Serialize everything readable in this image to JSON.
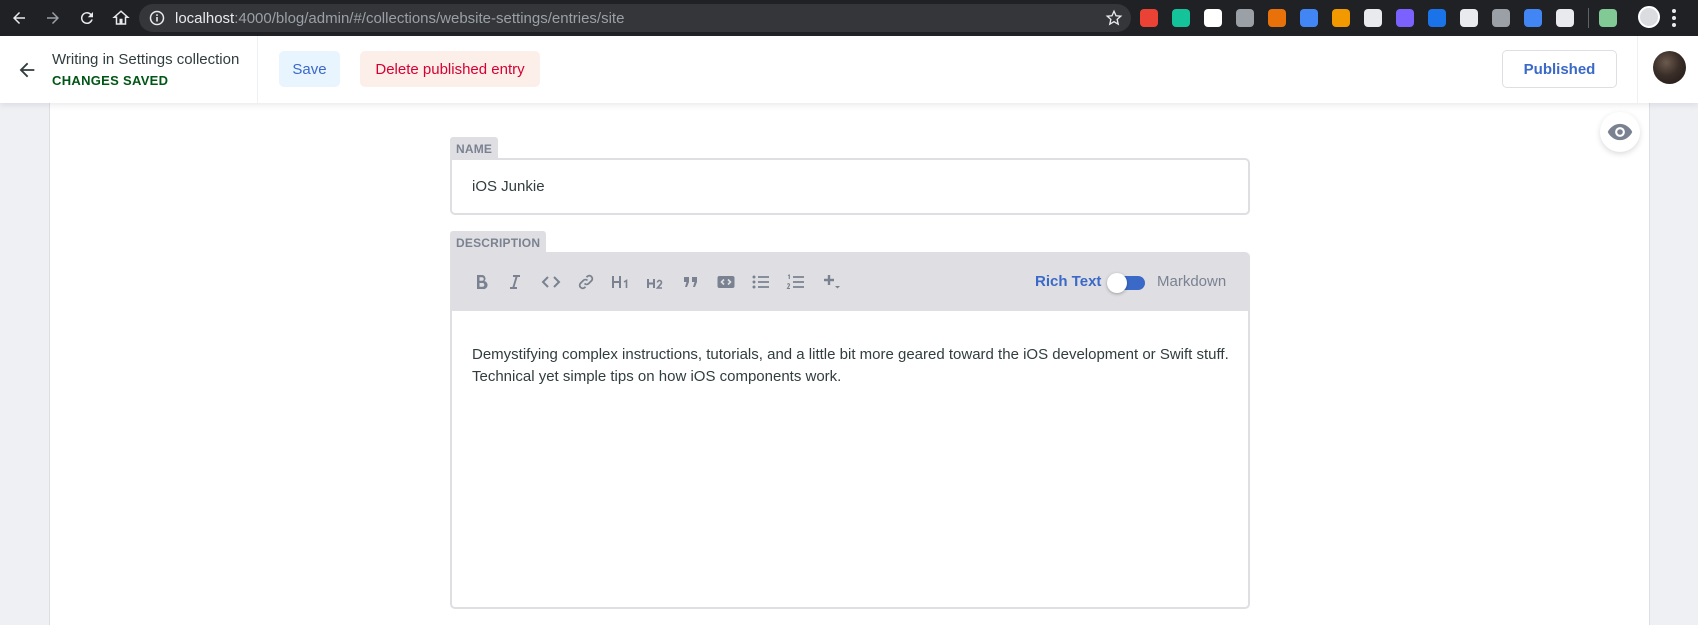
{
  "browser": {
    "url_host": "localhost",
    "url_path": ":4000/blog/admin/#/collections/website-settings/entries/site",
    "extension_colors": [
      "#ea4335",
      "#15c39a",
      "#ffffff",
      "#9aa0a6",
      "#e8710a",
      "#4285f4",
      "#f29900",
      "#e8eaed",
      "#7b61ff",
      "#1a73e8",
      "#e8eaed",
      "#9aa0a6",
      "#4285f4",
      "#e8eaed",
      "#81c995"
    ]
  },
  "topbar": {
    "collection_label": "Writing in Settings collection",
    "status": "CHANGES SAVED",
    "save_label": "Save",
    "delete_label": "Delete published entry",
    "published_label": "Published"
  },
  "form": {
    "name_label": "NAME",
    "name_value": "iOS Junkie",
    "description_label": "DESCRIPTION",
    "toolbar_icons": [
      "bold-icon",
      "italic-icon",
      "code-icon",
      "link-icon",
      "heading-one-icon",
      "heading-two-icon",
      "quote-icon",
      "code-block-icon",
      "bulleted-list-icon",
      "numbered-list-icon",
      "add-component-icon"
    ],
    "mode_rich_text": "Rich Text",
    "mode_markdown": "Markdown",
    "description_value": "Demystifying complex instructions, tutorials, and a little bit more geared toward the iOS development or Swift stuff. Technical yet simple tips on how iOS components work."
  },
  "colors": {
    "accent": "#3a69c7",
    "success": "#005614",
    "danger": "#d60032"
  }
}
